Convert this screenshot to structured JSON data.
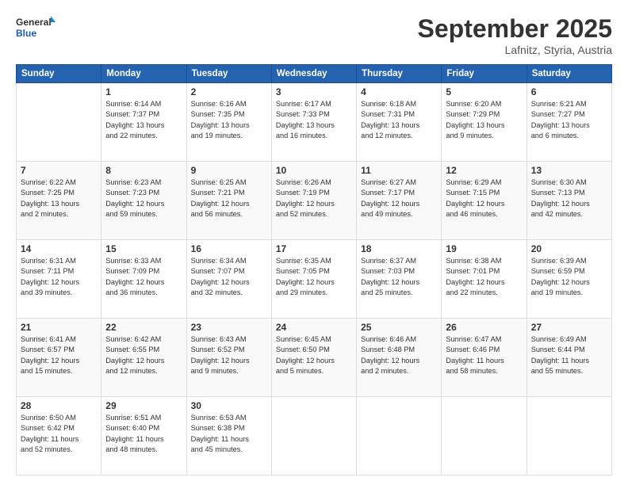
{
  "logo": {
    "line1": "General",
    "line2": "Blue"
  },
  "header": {
    "month": "September 2025",
    "location": "Lafnitz, Styria, Austria"
  },
  "weekdays": [
    "Sunday",
    "Monday",
    "Tuesday",
    "Wednesday",
    "Thursday",
    "Friday",
    "Saturday"
  ],
  "weeks": [
    [
      {
        "day": "",
        "lines": []
      },
      {
        "day": "1",
        "lines": [
          "Sunrise: 6:14 AM",
          "Sunset: 7:37 PM",
          "Daylight: 13 hours",
          "and 22 minutes."
        ]
      },
      {
        "day": "2",
        "lines": [
          "Sunrise: 6:16 AM",
          "Sunset: 7:35 PM",
          "Daylight: 13 hours",
          "and 19 minutes."
        ]
      },
      {
        "day": "3",
        "lines": [
          "Sunrise: 6:17 AM",
          "Sunset: 7:33 PM",
          "Daylight: 13 hours",
          "and 16 minutes."
        ]
      },
      {
        "day": "4",
        "lines": [
          "Sunrise: 6:18 AM",
          "Sunset: 7:31 PM",
          "Daylight: 13 hours",
          "and 12 minutes."
        ]
      },
      {
        "day": "5",
        "lines": [
          "Sunrise: 6:20 AM",
          "Sunset: 7:29 PM",
          "Daylight: 13 hours",
          "and 9 minutes."
        ]
      },
      {
        "day": "6",
        "lines": [
          "Sunrise: 6:21 AM",
          "Sunset: 7:27 PM",
          "Daylight: 13 hours",
          "and 6 minutes."
        ]
      }
    ],
    [
      {
        "day": "7",
        "lines": [
          "Sunrise: 6:22 AM",
          "Sunset: 7:25 PM",
          "Daylight: 13 hours",
          "and 2 minutes."
        ]
      },
      {
        "day": "8",
        "lines": [
          "Sunrise: 6:23 AM",
          "Sunset: 7:23 PM",
          "Daylight: 12 hours",
          "and 59 minutes."
        ]
      },
      {
        "day": "9",
        "lines": [
          "Sunrise: 6:25 AM",
          "Sunset: 7:21 PM",
          "Daylight: 12 hours",
          "and 56 minutes."
        ]
      },
      {
        "day": "10",
        "lines": [
          "Sunrise: 6:26 AM",
          "Sunset: 7:19 PM",
          "Daylight: 12 hours",
          "and 52 minutes."
        ]
      },
      {
        "day": "11",
        "lines": [
          "Sunrise: 6:27 AM",
          "Sunset: 7:17 PM",
          "Daylight: 12 hours",
          "and 49 minutes."
        ]
      },
      {
        "day": "12",
        "lines": [
          "Sunrise: 6:29 AM",
          "Sunset: 7:15 PM",
          "Daylight: 12 hours",
          "and 46 minutes."
        ]
      },
      {
        "day": "13",
        "lines": [
          "Sunrise: 6:30 AM",
          "Sunset: 7:13 PM",
          "Daylight: 12 hours",
          "and 42 minutes."
        ]
      }
    ],
    [
      {
        "day": "14",
        "lines": [
          "Sunrise: 6:31 AM",
          "Sunset: 7:11 PM",
          "Daylight: 12 hours",
          "and 39 minutes."
        ]
      },
      {
        "day": "15",
        "lines": [
          "Sunrise: 6:33 AM",
          "Sunset: 7:09 PM",
          "Daylight: 12 hours",
          "and 36 minutes."
        ]
      },
      {
        "day": "16",
        "lines": [
          "Sunrise: 6:34 AM",
          "Sunset: 7:07 PM",
          "Daylight: 12 hours",
          "and 32 minutes."
        ]
      },
      {
        "day": "17",
        "lines": [
          "Sunrise: 6:35 AM",
          "Sunset: 7:05 PM",
          "Daylight: 12 hours",
          "and 29 minutes."
        ]
      },
      {
        "day": "18",
        "lines": [
          "Sunrise: 6:37 AM",
          "Sunset: 7:03 PM",
          "Daylight: 12 hours",
          "and 25 minutes."
        ]
      },
      {
        "day": "19",
        "lines": [
          "Sunrise: 6:38 AM",
          "Sunset: 7:01 PM",
          "Daylight: 12 hours",
          "and 22 minutes."
        ]
      },
      {
        "day": "20",
        "lines": [
          "Sunrise: 6:39 AM",
          "Sunset: 6:59 PM",
          "Daylight: 12 hours",
          "and 19 minutes."
        ]
      }
    ],
    [
      {
        "day": "21",
        "lines": [
          "Sunrise: 6:41 AM",
          "Sunset: 6:57 PM",
          "Daylight: 12 hours",
          "and 15 minutes."
        ]
      },
      {
        "day": "22",
        "lines": [
          "Sunrise: 6:42 AM",
          "Sunset: 6:55 PM",
          "Daylight: 12 hours",
          "and 12 minutes."
        ]
      },
      {
        "day": "23",
        "lines": [
          "Sunrise: 6:43 AM",
          "Sunset: 6:52 PM",
          "Daylight: 12 hours",
          "and 9 minutes."
        ]
      },
      {
        "day": "24",
        "lines": [
          "Sunrise: 6:45 AM",
          "Sunset: 6:50 PM",
          "Daylight: 12 hours",
          "and 5 minutes."
        ]
      },
      {
        "day": "25",
        "lines": [
          "Sunrise: 6:46 AM",
          "Sunset: 6:48 PM",
          "Daylight: 12 hours",
          "and 2 minutes."
        ]
      },
      {
        "day": "26",
        "lines": [
          "Sunrise: 6:47 AM",
          "Sunset: 6:46 PM",
          "Daylight: 11 hours",
          "and 58 minutes."
        ]
      },
      {
        "day": "27",
        "lines": [
          "Sunrise: 6:49 AM",
          "Sunset: 6:44 PM",
          "Daylight: 11 hours",
          "and 55 minutes."
        ]
      }
    ],
    [
      {
        "day": "28",
        "lines": [
          "Sunrise: 6:50 AM",
          "Sunset: 6:42 PM",
          "Daylight: 11 hours",
          "and 52 minutes."
        ]
      },
      {
        "day": "29",
        "lines": [
          "Sunrise: 6:51 AM",
          "Sunset: 6:40 PM",
          "Daylight: 11 hours",
          "and 48 minutes."
        ]
      },
      {
        "day": "30",
        "lines": [
          "Sunrise: 6:53 AM",
          "Sunset: 6:38 PM",
          "Daylight: 11 hours",
          "and 45 minutes."
        ]
      },
      {
        "day": "",
        "lines": []
      },
      {
        "day": "",
        "lines": []
      },
      {
        "day": "",
        "lines": []
      },
      {
        "day": "",
        "lines": []
      }
    ]
  ]
}
